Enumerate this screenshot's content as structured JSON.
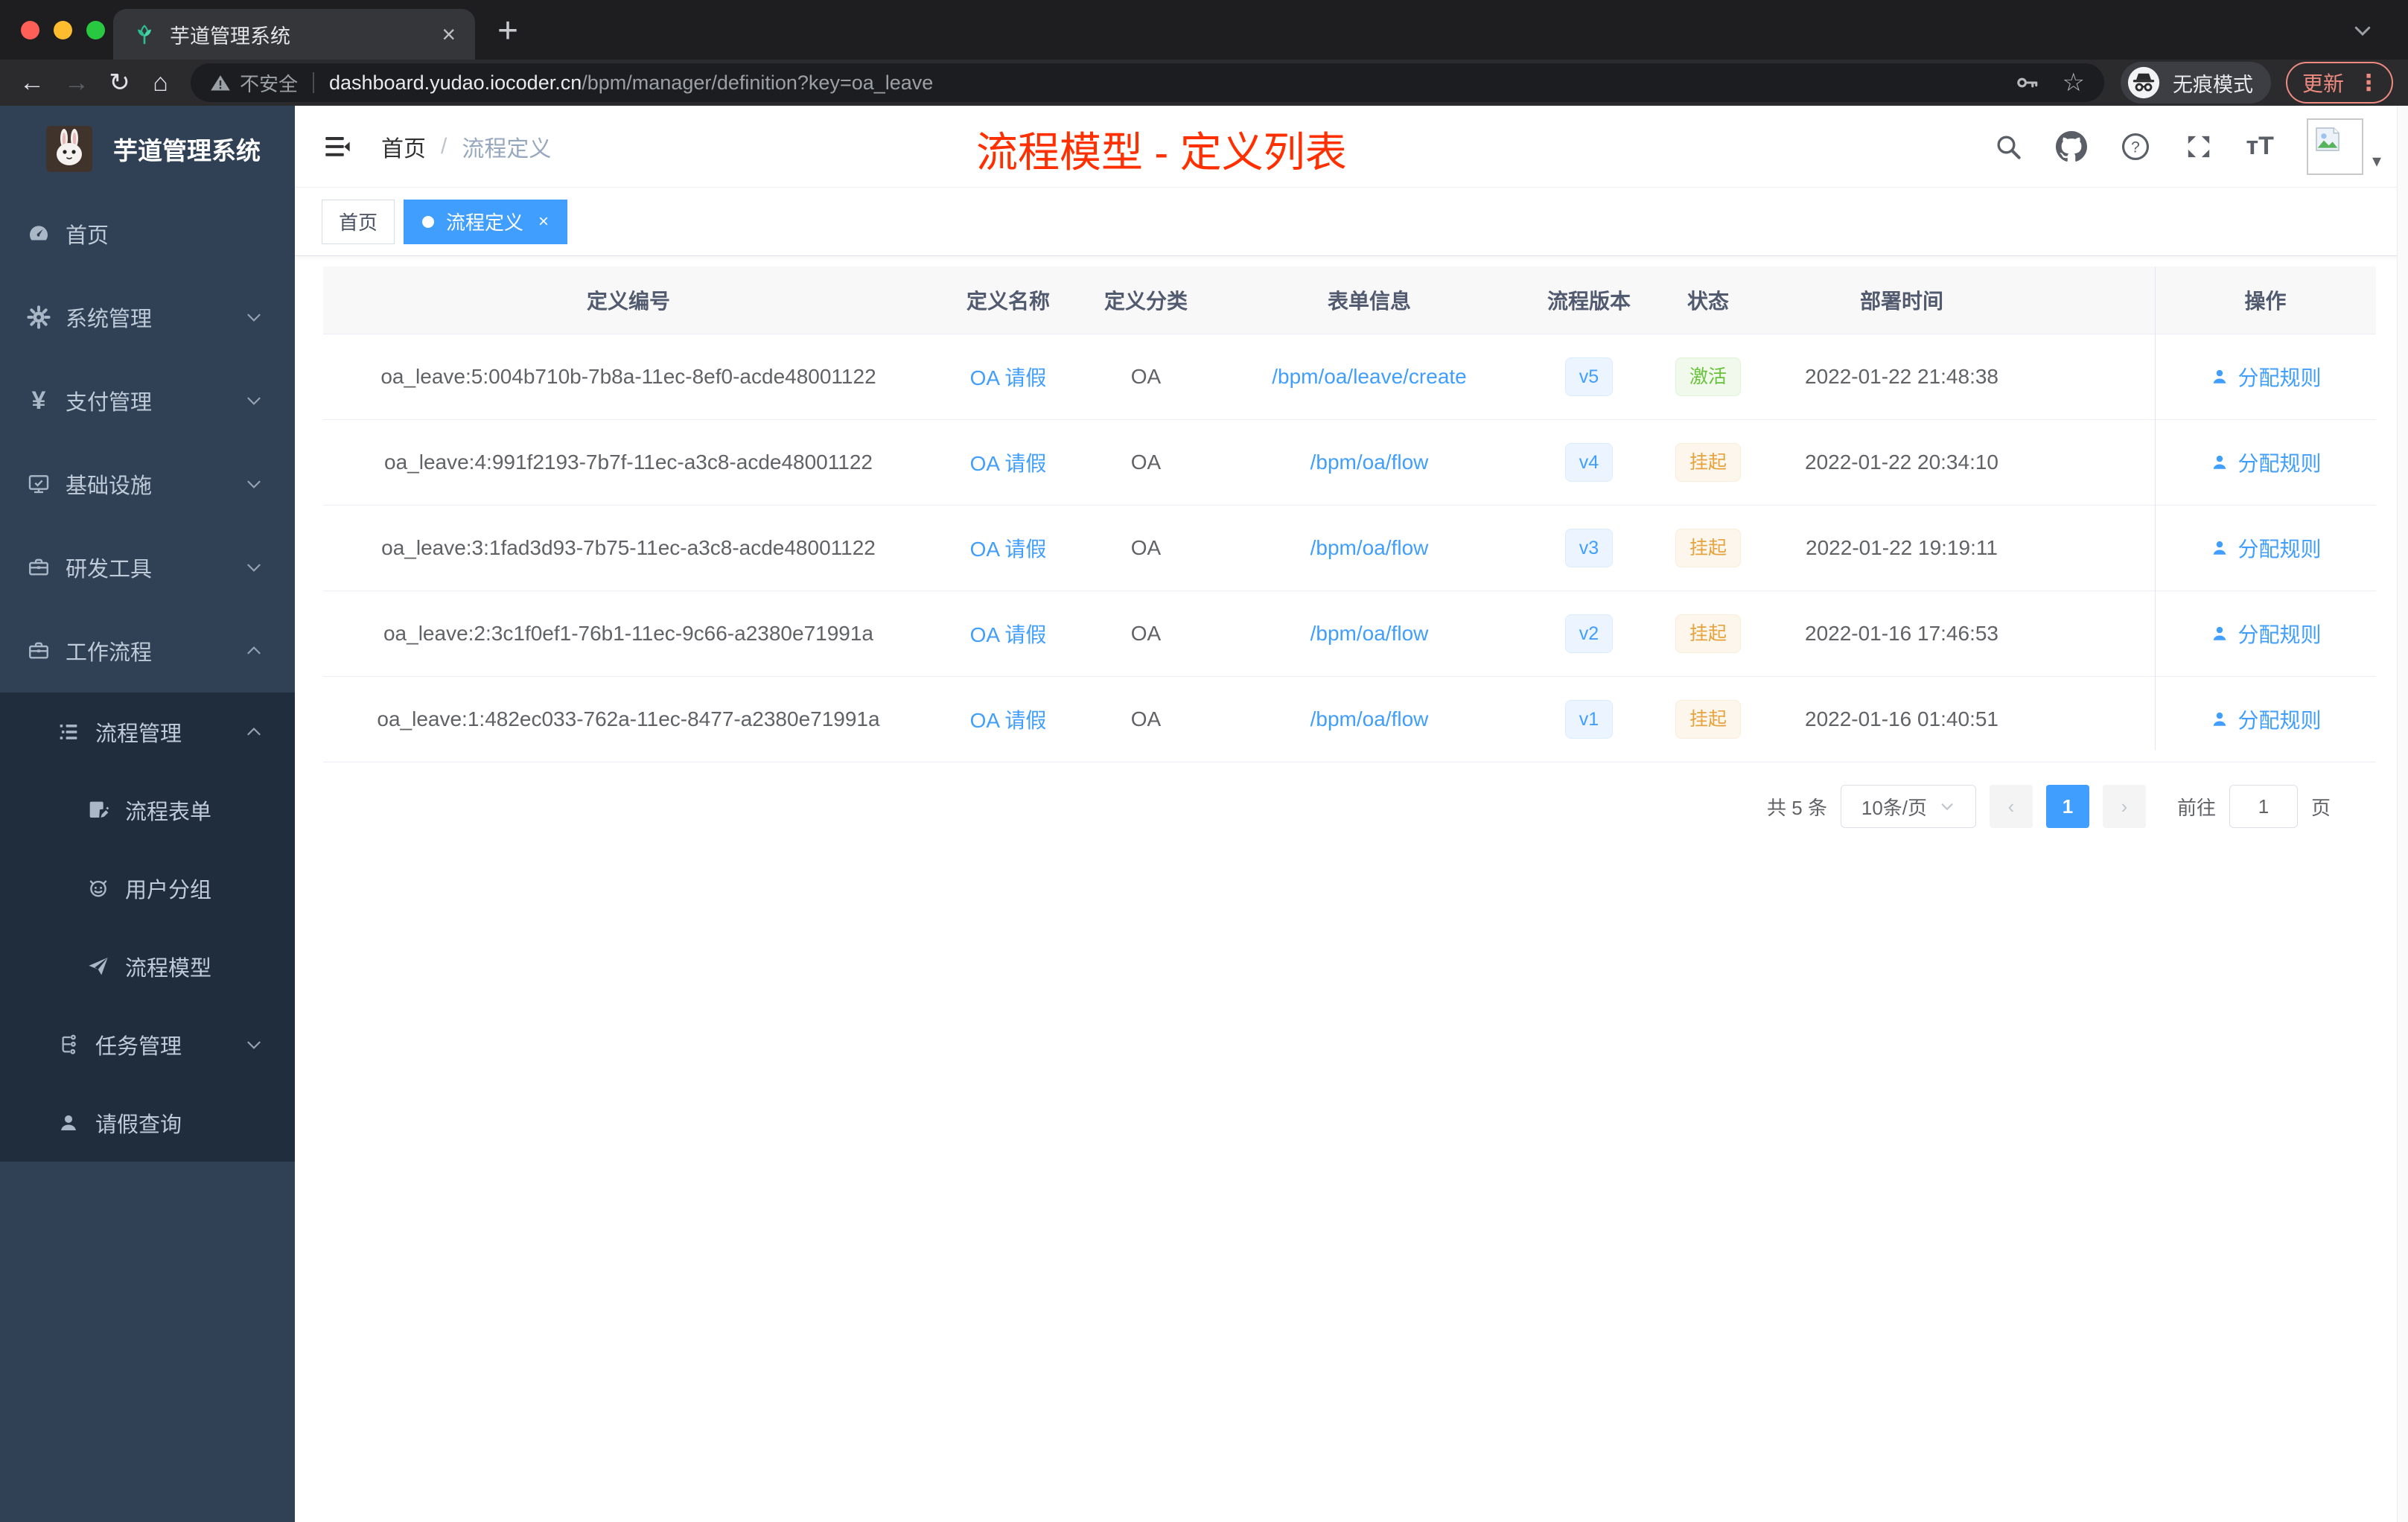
{
  "browser": {
    "tab_title": "芋道管理系统",
    "tab_close": "×",
    "new_tab": "+",
    "back": "←",
    "forward": "→",
    "reload": "↻",
    "home": "⌂",
    "security_label": "不安全",
    "url_host": "dashboard.yudao.iocoder.cn",
    "url_path": "/bpm/manager/definition?key=oa_leave",
    "star": "☆",
    "incognito_label": "无痕模式",
    "update_label": "更新",
    "update_dots": "⋮"
  },
  "sidebar": {
    "logo_title": "芋道管理系统",
    "items": [
      {
        "label": "首页",
        "icon": "dashboard-icon",
        "level": 1,
        "chevron": null,
        "dark": false
      },
      {
        "label": "系统管理",
        "icon": "gear-icon",
        "level": 1,
        "chevron": "down",
        "dark": false
      },
      {
        "label": "支付管理",
        "icon": "yen-icon",
        "level": 1,
        "chevron": "down",
        "dark": false
      },
      {
        "label": "基础设施",
        "icon": "monitor-icon",
        "level": 1,
        "chevron": "down",
        "dark": false
      },
      {
        "label": "研发工具",
        "icon": "toolbox-icon",
        "level": 1,
        "chevron": "down",
        "dark": false
      },
      {
        "label": "工作流程",
        "icon": "briefcase-icon",
        "level": 1,
        "chevron": "up",
        "dark": false
      },
      {
        "label": "流程管理",
        "icon": "list-tree-icon",
        "level": 2,
        "chevron": "up",
        "dark": true
      },
      {
        "label": "流程表单",
        "icon": "form-edit-icon",
        "level": 3,
        "chevron": null,
        "dark": true
      },
      {
        "label": "用户分组",
        "icon": "user-group-icon",
        "level": 3,
        "chevron": null,
        "dark": true
      },
      {
        "label": "流程模型",
        "icon": "paper-plane-icon",
        "level": 3,
        "chevron": null,
        "dark": true
      },
      {
        "label": "任务管理",
        "icon": "task-tree-icon",
        "level": 2,
        "chevron": "down",
        "dark": true
      },
      {
        "label": "请假查询",
        "icon": "user-icon",
        "level": 2,
        "chevron": null,
        "dark": true
      }
    ]
  },
  "header": {
    "breadcrumb_home": "首页",
    "breadcrumb_sep": "/",
    "breadcrumb_current": "流程定义",
    "annotation": "流程模型 - 定义列表",
    "avatar_caret": "▾"
  },
  "tags": [
    {
      "label": "首页",
      "active": false
    },
    {
      "label": "流程定义",
      "active": true
    }
  ],
  "table": {
    "columns": [
      "定义编号",
      "定义名称",
      "定义分类",
      "表单信息",
      "流程版本",
      "状态",
      "部署时间",
      "",
      "操作"
    ],
    "rows": [
      {
        "id": "oa_leave:5:004b710b-7b8a-11ec-8ef0-acde48001122",
        "name": "OA 请假",
        "category": "OA",
        "form": "/bpm/oa/leave/create",
        "version": "v5",
        "status": "激活",
        "status_type": "success",
        "deploy_time": "2022-01-22 21:48:38",
        "action": "分配规则"
      },
      {
        "id": "oa_leave:4:991f2193-7b7f-11ec-a3c8-acde48001122",
        "name": "OA 请假",
        "category": "OA",
        "form": "/bpm/oa/flow",
        "version": "v4",
        "status": "挂起",
        "status_type": "warning",
        "deploy_time": "2022-01-22 20:34:10",
        "action": "分配规则"
      },
      {
        "id": "oa_leave:3:1fad3d93-7b75-11ec-a3c8-acde48001122",
        "name": "OA 请假",
        "category": "OA",
        "form": "/bpm/oa/flow",
        "version": "v3",
        "status": "挂起",
        "status_type": "warning",
        "deploy_time": "2022-01-22 19:19:11",
        "action": "分配规则"
      },
      {
        "id": "oa_leave:2:3c1f0ef1-76b1-11ec-9c66-a2380e71991a",
        "name": "OA 请假",
        "category": "OA",
        "form": "/bpm/oa/flow",
        "version": "v2",
        "status": "挂起",
        "status_type": "warning",
        "deploy_time": "2022-01-16 17:46:53",
        "action": "分配规则"
      },
      {
        "id": "oa_leave:1:482ec033-762a-11ec-8477-a2380e71991a",
        "name": "OA 请假",
        "category": "OA",
        "form": "/bpm/oa/flow",
        "version": "v1",
        "status": "挂起",
        "status_type": "warning",
        "deploy_time": "2022-01-16 01:40:51",
        "action": "分配规则"
      }
    ]
  },
  "pagination": {
    "total_label": "共 5 条",
    "page_size_label": "10条/页",
    "prev": "‹",
    "current_page": "1",
    "next": "›",
    "goto_label": "前往",
    "goto_value": "1",
    "page_unit_label": "页"
  },
  "colors": {
    "accent": "#409eff",
    "success": "#67c23a",
    "warning": "#e6a23c",
    "annotation_red": "#ff2f00",
    "sidebar_bg": "#304156",
    "submenu_bg": "#1f2d3d"
  }
}
